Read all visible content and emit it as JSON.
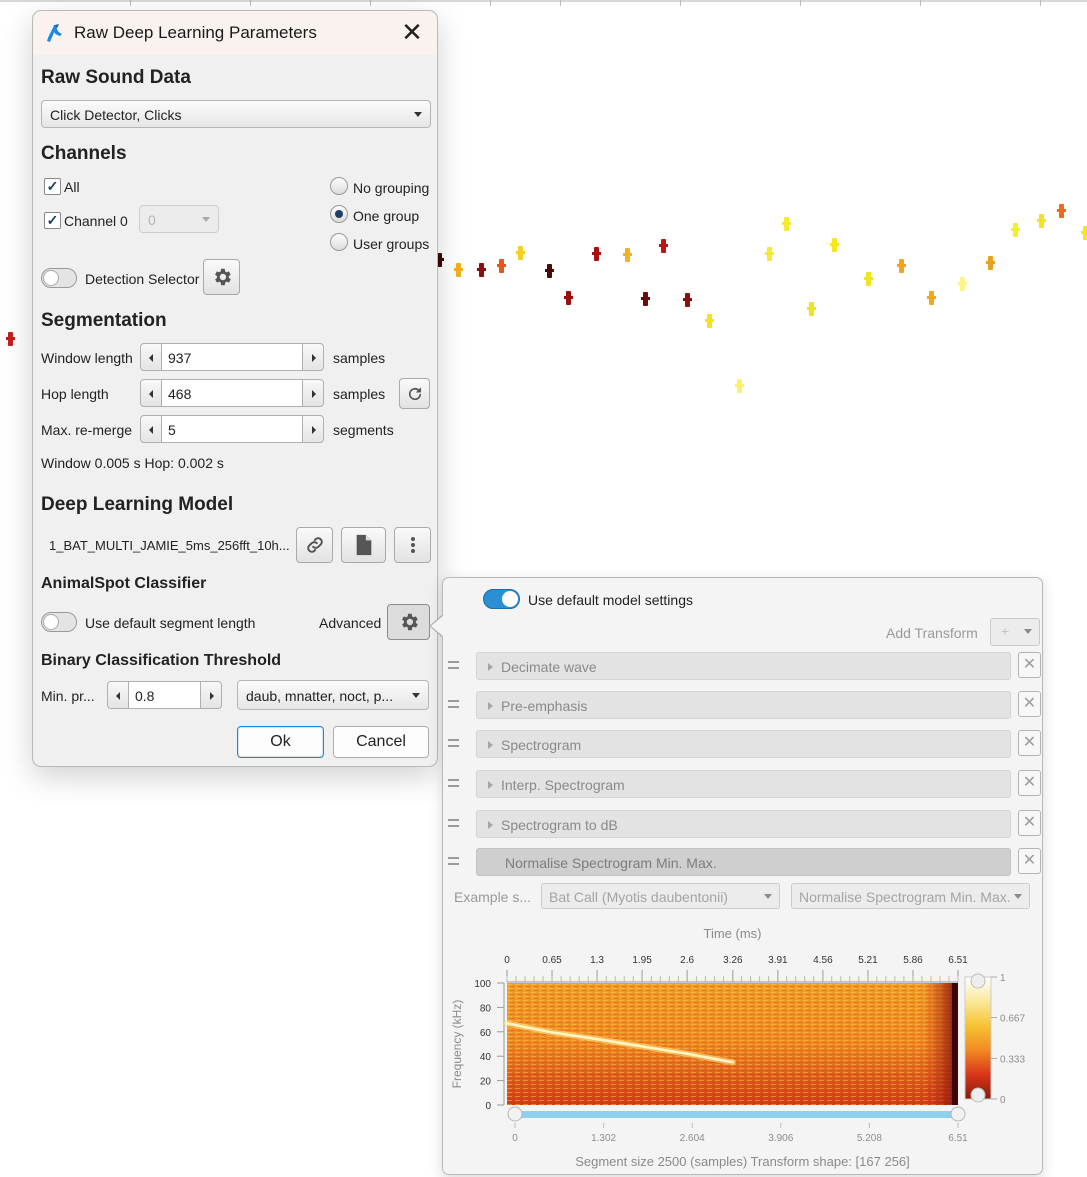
{
  "background": {
    "detections": [
      {
        "color": "#c41e1e"
      },
      {
        "color": "#3a0606"
      },
      {
        "color": "#f2b11c"
      },
      {
        "color": "#8b0d0d"
      },
      {
        "color": "#e2561a"
      },
      {
        "color": "#f2d21f"
      },
      {
        "color": "#4a0808"
      },
      {
        "color": "#9c0e0e"
      },
      {
        "color": "#a81010"
      },
      {
        "color": "#f5b321"
      },
      {
        "color": "#6e0a0a"
      },
      {
        "color": "#c01414"
      },
      {
        "color": "#8e0f0f"
      },
      {
        "color": "#f3e21c"
      },
      {
        "color": "#f9f26a"
      },
      {
        "color": "#f4e935"
      },
      {
        "color": "#f6ea2e"
      },
      {
        "color": "#f2e321"
      },
      {
        "color": "#f5e61e"
      },
      {
        "color": "#f0e421"
      },
      {
        "color": "#f3a31c"
      },
      {
        "color": "#f1a81f"
      },
      {
        "color": "#fbf488"
      },
      {
        "color": "#eba01c"
      },
      {
        "color": "#f4ef2b"
      },
      {
        "color": "#f4e224"
      },
      {
        "color": "#ef6a1b"
      },
      {
        "color": "#f4e421"
      },
      {
        "color": "#e22d17"
      }
    ]
  },
  "dialog": {
    "title": "Raw Deep Learning Parameters",
    "raw_sound_data": {
      "heading": "Raw Sound Data",
      "source": "Click Detector, Clicks"
    },
    "channels": {
      "heading": "Channels",
      "all_label": "All",
      "all_checked": true,
      "channel0_label": "Channel 0",
      "channel0_checked": true,
      "channel0_group": "0",
      "grouping": [
        {
          "label": "No grouping",
          "selected": false
        },
        {
          "label": "One group",
          "selected": true
        },
        {
          "label": "User groups",
          "selected": false
        }
      ],
      "detection_selector_label": "Detection Selector"
    },
    "segmentation": {
      "heading": "Segmentation",
      "window_label": "Window length",
      "window_value": "937",
      "window_unit": "samples",
      "hop_label": "Hop length",
      "hop_value": "468",
      "hop_unit": "samples",
      "remerge_label": "Max. re-merge",
      "remerge_value": "5",
      "remerge_unit": "segments",
      "summary": "Window 0.005 s Hop: 0.002 s"
    },
    "model": {
      "heading": "Deep Learning Model",
      "path": "1_BAT_MULTI_JAMIE_5ms_256fft_10h..."
    },
    "classifier": {
      "heading": "AnimalSpot Classifier",
      "default_segment_label": "Use default segment length",
      "advanced_label": "Advanced"
    },
    "threshold": {
      "heading": "Binary Classification Threshold",
      "min_label": "Min. pr...",
      "min_value": "0.8",
      "classes": "daub, mnatter, noct, p..."
    },
    "ok_label": "Ok",
    "cancel_label": "Cancel"
  },
  "advanced": {
    "default_model_label": "Use default model settings",
    "default_model_on": true,
    "add_transform_label": "Add Transform",
    "add_transform_button": "+",
    "transforms": [
      {
        "label": "Decimate wave"
      },
      {
        "label": "Pre-emphasis"
      },
      {
        "label": "Spectrogram"
      },
      {
        "label": "Interp. Spectrogram"
      },
      {
        "label": "Spectrogram to dB"
      },
      {
        "label": "Normalise Spectrogram Min. Max."
      }
    ],
    "remove_symbol": "✕",
    "example_label": "Example s...",
    "example_species": "Bat Call (Myotis daubentonii)",
    "example_transform": "Normalise Spectrogram Min. Max.",
    "footer": "Segment size 2500 (samples) Transform shape: [167 256]"
  },
  "chart_data": {
    "type": "heatmap",
    "title": "",
    "xlabel": "Time (ms)",
    "ylabel": "Frequency (kHz)",
    "x_ticks": [
      "0",
      "0.65",
      "1.3",
      "1.95",
      "2.6",
      "3.26",
      "3.91",
      "4.56",
      "5.21",
      "5.86",
      "6.51"
    ],
    "y_ticks": [
      "100",
      "80",
      "60",
      "40",
      "20",
      "0"
    ],
    "xlim": [
      0,
      6.51
    ],
    "ylim": [
      0,
      100
    ],
    "colorbar_ticks": [
      "1",
      "0.667",
      "0.333",
      "0"
    ],
    "colorbar_range": [
      0,
      1
    ],
    "sample_ticks": [
      "0",
      "1.302",
      "2.604",
      "3.906",
      "5.208",
      "6.51"
    ],
    "sample_range": [
      0,
      6.51
    ],
    "call_trace": [
      {
        "t": 0.0,
        "f": 67
      },
      {
        "t": 0.6,
        "f": 60
      },
      {
        "t": 1.3,
        "f": 54
      },
      {
        "t": 1.95,
        "f": 48
      },
      {
        "t": 2.6,
        "f": 42
      },
      {
        "t": 3.26,
        "f": 35
      }
    ],
    "colormap": [
      "#8b1a0b",
      "#d8351a",
      "#f28a22",
      "#f6c232",
      "#fbe89a",
      "#ffffff"
    ],
    "grid": false
  }
}
